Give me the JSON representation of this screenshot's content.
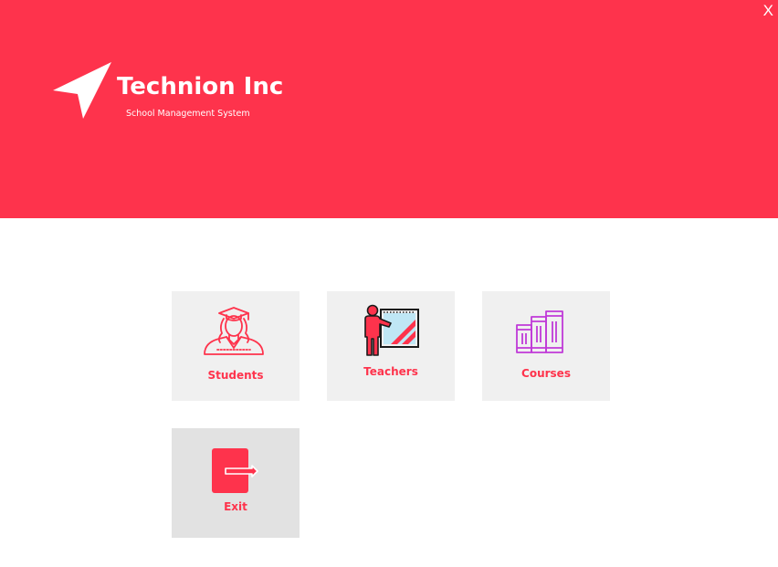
{
  "window": {
    "close_label": "X"
  },
  "header": {
    "title": "Technion Inc",
    "subtitle": "School Management System",
    "logo_icon": "send-arrow-icon",
    "background_color": "#fe334c"
  },
  "tiles": [
    {
      "label": "Students",
      "icon": "graduate-student-icon"
    },
    {
      "label": "Teachers",
      "icon": "teacher-whiteboard-icon"
    },
    {
      "label": "Courses",
      "icon": "books-icon"
    },
    {
      "label": "Exit",
      "icon": "exit-door-icon"
    }
  ],
  "colors": {
    "accent": "#fe334c",
    "tile_background": "#f0f0f0",
    "exit_tile_background": "#e2e2e2",
    "courses_icon": "#c03ad8"
  }
}
